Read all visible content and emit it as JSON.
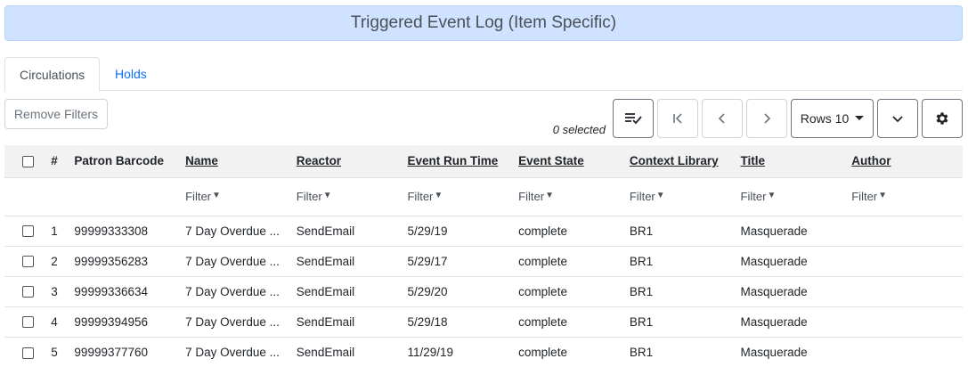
{
  "header": {
    "title": "Triggered Event Log (Item Specific)"
  },
  "tabs": [
    {
      "label": "Circulations",
      "active": true
    },
    {
      "label": "Holds",
      "active": false
    }
  ],
  "toolbar": {
    "remove_filters_label": "Remove Filters",
    "selected_text": "0 selected",
    "rows_label": "Rows 10",
    "icons": [
      "select-all-icon",
      "first-page-icon",
      "prev-page-icon",
      "next-page-icon",
      "caret-down-icon",
      "chevron-down-icon",
      "gear-icon"
    ]
  },
  "table": {
    "columns": [
      "#",
      "Patron Barcode",
      "Name",
      "Reactor",
      "Event Run Time",
      "Event State",
      "Context Library",
      "Title",
      "Author"
    ],
    "filter_label": "Filter",
    "rows": [
      {
        "num": "1",
        "barcode": "99999333308",
        "name": "7 Day Overdue ...",
        "reactor": "SendEmail",
        "run_time": "5/29/19",
        "state": "complete",
        "library": "BR1",
        "title": "Masquerade",
        "author": ""
      },
      {
        "num": "2",
        "barcode": "99999356283",
        "name": "7 Day Overdue ...",
        "reactor": "SendEmail",
        "run_time": "5/29/17",
        "state": "complete",
        "library": "BR1",
        "title": "Masquerade",
        "author": ""
      },
      {
        "num": "3",
        "barcode": "99999336634",
        "name": "7 Day Overdue ...",
        "reactor": "SendEmail",
        "run_time": "5/29/20",
        "state": "complete",
        "library": "BR1",
        "title": "Masquerade",
        "author": ""
      },
      {
        "num": "4",
        "barcode": "99999394956",
        "name": "7 Day Overdue ...",
        "reactor": "SendEmail",
        "run_time": "5/29/18",
        "state": "complete",
        "library": "BR1",
        "title": "Masquerade",
        "author": ""
      },
      {
        "num": "5",
        "barcode": "99999377760",
        "name": "7 Day Overdue ...",
        "reactor": "SendEmail",
        "run_time": "11/29/19",
        "state": "complete",
        "library": "BR1",
        "title": "Masquerade",
        "author": ""
      }
    ]
  }
}
